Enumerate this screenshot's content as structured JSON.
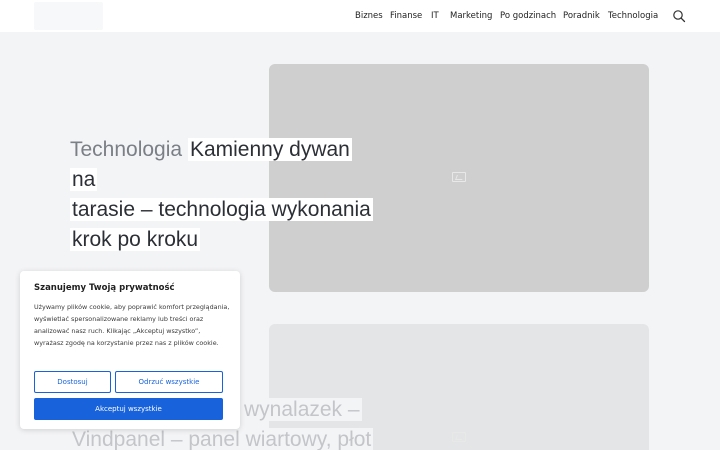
{
  "header": {
    "nav": [
      {
        "label": "Biznes"
      },
      {
        "label": "Finanse"
      },
      {
        "label": "IT"
      },
      {
        "label": "Marketing"
      },
      {
        "label": "Po godzinach"
      },
      {
        "label": "Poradnik"
      },
      {
        "label": "Technologia"
      }
    ]
  },
  "posts": [
    {
      "category": "Technologia",
      "title_lines": [
        "Kamienny dywan na",
        "tarasie – technologia wykonania",
        "krok po kroku"
      ]
    },
    {
      "title_lines": [
        "wynalazek –",
        "Vindpanel – panel wiartowy, płot"
      ]
    }
  ],
  "cookie": {
    "title": "Szanujemy Twoją prywatność",
    "text": "Używamy plików cookie, aby poprawić komfort przeglądania, wyświetlać spersonalizowane reklamy lub treści oraz analizować nasz ruch. Klikając „Akceptuj wszystko”, wyrażasz zgodę na korzystanie przez nas z plików cookie.",
    "customize": "Dostosuj",
    "reject": "Odrzuć wszystkie",
    "accept": "Akceptuj wszystkie"
  }
}
